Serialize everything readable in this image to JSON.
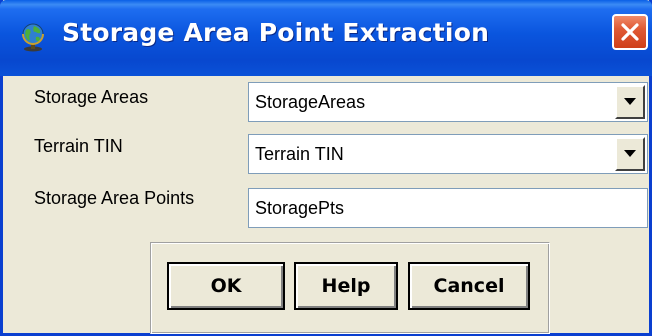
{
  "window": {
    "title": "Storage Area Point Extraction",
    "title_icon": "globe-icon",
    "close_icon": "close-icon"
  },
  "form": {
    "storage_areas": {
      "label": "Storage Areas",
      "value": "StorageAreas"
    },
    "terrain_tin": {
      "label": "Terrain TIN",
      "value": "Terrain TIN"
    },
    "storage_area_points": {
      "label": "Storage Area Points",
      "value": "StoragePts"
    }
  },
  "buttons": {
    "ok": "OK",
    "help": "Help",
    "cancel": "Cancel"
  },
  "colors": {
    "titlebar": "#0a55de",
    "close_button": "#e05a35",
    "dialog_background": "#ece9d8"
  }
}
